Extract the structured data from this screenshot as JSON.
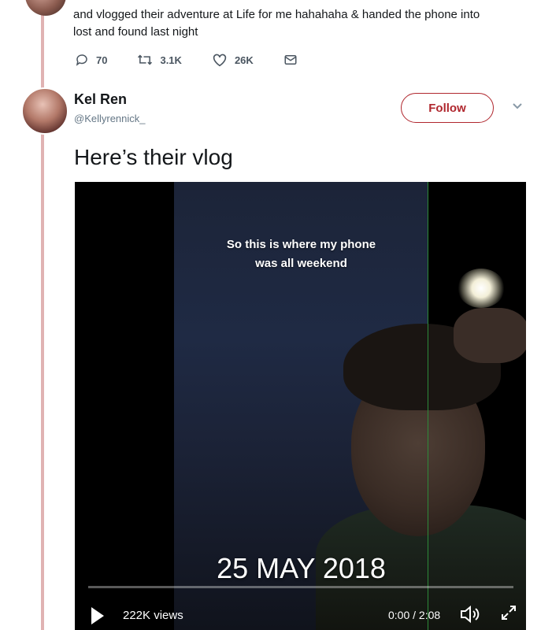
{
  "previous_tweet": {
    "text_line1": "and vlogged their adventure at Life for me hahahaha & handed the phone into",
    "text_line2": "lost and found last night",
    "actions": {
      "reply_count": "70",
      "retweet_count": "3.1K",
      "like_count": "26K"
    }
  },
  "tweet": {
    "author_name": "Kel Ren",
    "author_handle": "@Kellyrennick_",
    "follow_label": "Follow",
    "text": "Here’s their vlog",
    "video": {
      "caption_line1": "So this is where my phone",
      "caption_line2": "was all weekend",
      "date_overlay": "25 MAY 2018",
      "views": "222K views",
      "time": "0:00 / 2:08",
      "progress_fraction": 0
    }
  },
  "colors": {
    "accent": "#b0272e",
    "thread_line": "#e0b3b3"
  },
  "icons": [
    "reply-icon",
    "retweet-icon",
    "like-icon",
    "message-icon",
    "chevron-down-icon",
    "play-icon",
    "volume-icon",
    "expand-icon"
  ]
}
